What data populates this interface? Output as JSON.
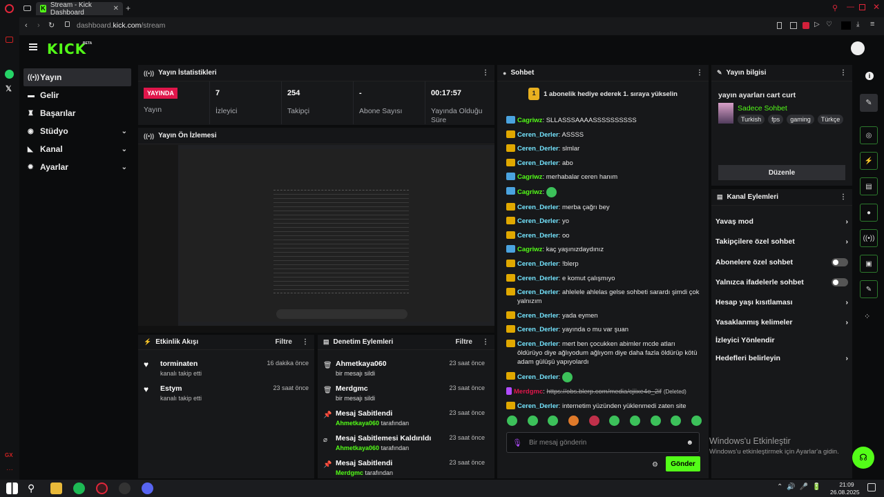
{
  "browser": {
    "tab_title": "Stream - Kick Dashboard",
    "url_domain": "dashboard.",
    "url_host": "kick.com",
    "url_path": "/stream"
  },
  "brand": {
    "logo": "KICK",
    "beta": "BETA",
    "accent": "#53fc18"
  },
  "sidebar": {
    "items": [
      {
        "label": "Yayın",
        "icon": "broadcast-icon"
      },
      {
        "label": "Gelir",
        "icon": "money-icon"
      },
      {
        "label": "Başarılar",
        "icon": "trophy-icon"
      },
      {
        "label": "Stüdyo",
        "icon": "studio-icon"
      },
      {
        "label": "Kanal",
        "icon": "channel-icon"
      },
      {
        "label": "Ayarlar",
        "icon": "gear-icon"
      }
    ]
  },
  "stats": {
    "title": "Yayın İstatistikleri",
    "live_badge": "YAYINDA",
    "live_label": "Yayın",
    "items": [
      {
        "value": "7",
        "label": "İzleyici"
      },
      {
        "value": "254",
        "label": "Takipçi"
      },
      {
        "value": "-",
        "label": "Abone Sayısı"
      },
      {
        "value": "00:17:57",
        "label": "Yayında Olduğu Süre"
      }
    ]
  },
  "preview": {
    "title": "Yayın Ön İzlemesi"
  },
  "activity": {
    "title": "Etkinlik Akışı",
    "filter": "Filtre",
    "items": [
      {
        "name": "torminaten",
        "sub": "kanalı takip etti",
        "time": "16 dakika önce"
      },
      {
        "name": "Estym",
        "sub": "kanalı takip etti",
        "time": "23 saat önce"
      }
    ]
  },
  "moderation": {
    "title": "Denetim Eylemleri",
    "filter": "Filtre",
    "items": [
      {
        "title": "Ahmetkaya060",
        "sub": "bir mesajı sildi",
        "time": "23 saat önce",
        "user": "",
        "icon": "trash-icon"
      },
      {
        "title": "Merdgmc",
        "sub": "bir mesajı sildi",
        "time": "23 saat önce",
        "user": "",
        "icon": "trash-icon"
      },
      {
        "title": "Mesaj Sabitlendi",
        "sub": "tarafından",
        "time": "23 saat önce",
        "user": "Ahmetkaya060",
        "icon": "pin-icon"
      },
      {
        "title": "Mesaj Sabitlemesi Kaldırıldı",
        "sub": "tarafından",
        "time": "23 saat önce",
        "user": "Ahmetkaya060",
        "icon": "unpin-icon"
      },
      {
        "title": "Mesaj Sabitlendi",
        "sub": "tarafından",
        "time": "23 saat önce",
        "user": "Merdgmc",
        "icon": "pin-icon"
      }
    ]
  },
  "chat": {
    "title": "Sohbet",
    "gift_banner": "1 abonelik hediye ederek 1. sıraya yükselin",
    "gift_rank": "1",
    "input_placeholder": "Bir mesaj gönderin",
    "send": "Gönder",
    "messages": [
      {
        "user": "Cagriwz",
        "text": "SLLASSSAAAASSSSSSSSSS",
        "badge": "blue"
      },
      {
        "user": "Ceren_Derler",
        "text": "ASSSS",
        "badge": "gold"
      },
      {
        "user": "Ceren_Derler",
        "text": "slmlar",
        "badge": "gold"
      },
      {
        "user": "Ceren_Derler",
        "text": "abo",
        "badge": "gold"
      },
      {
        "user": "Cagriwz",
        "text": "merhabalar ceren hanım",
        "badge": "blue"
      },
      {
        "user": "Cagriwz",
        "text": "",
        "badge": "blue",
        "emote": true
      },
      {
        "user": "Ceren_Derler",
        "text": "merba çağrı bey",
        "badge": "gold"
      },
      {
        "user": "Ceren_Derler",
        "text": "yo",
        "badge": "gold"
      },
      {
        "user": "Ceren_Derler",
        "text": "oo",
        "badge": "gold"
      },
      {
        "user": "Cagriwz",
        "text": "kaç yaşınızdaydınız",
        "badge": "blue"
      },
      {
        "user": "Ceren_Derler",
        "text": "!blerp",
        "badge": "gold"
      },
      {
        "user": "Ceren_Derler",
        "text": "e komut çalışmıyo",
        "badge": "gold"
      },
      {
        "user": "Ceren_Derler",
        "text": "ahlelele ahlelas gelse sohbeti sarardı şimdi çok yalnızım",
        "badge": "gold"
      },
      {
        "user": "Ceren_Derler",
        "text": "yada eymen",
        "badge": "gold"
      },
      {
        "user": "Ceren_Derler",
        "text": "yayında o mu var şuan",
        "badge": "gold"
      },
      {
        "user": "Ceren_Derler",
        "text": "mert ben çocukken abimler mcde atları öldürüyo diye ağlıyodum ağlıyom diye daha fazla öldürüp kötü adam gülüşü yapıyolardı",
        "badge": "gold"
      },
      {
        "user": "Ceren_Derler",
        "text": "",
        "badge": "gold",
        "emote": true
      },
      {
        "user": "Merdgmc",
        "text": "https://obs.blerp.com/media/cjiixe4o_2if",
        "deleted": "(Deleted)",
        "badge": "mic"
      },
      {
        "user": "Ceren_Derler",
        "text": "internetim yüzünden yüklenmedi zaten site",
        "badge": "gold"
      }
    ]
  },
  "stream_info": {
    "title": "Yayın bilgisi",
    "stream_title": "yayın ayarları cart curt",
    "category": "Sadece Sohbet",
    "tags": [
      "Turkish",
      "fps",
      "gaming",
      "Türkçe"
    ],
    "edit": "Düzenle"
  },
  "channel_actions": {
    "title": "Kanal Eylemleri",
    "items": [
      {
        "label": "Yavaş mod",
        "control": "chevron"
      },
      {
        "label": "Takipçilere özel sohbet",
        "control": "chevron"
      },
      {
        "label": "Abonelere özel sohbet",
        "control": "toggle",
        "on": false
      },
      {
        "label": "Yalnızca ifadelerle sohbet",
        "control": "toggle",
        "on": false
      },
      {
        "label": "Hesap yaşı kısıtlaması",
        "control": "chevron"
      },
      {
        "label": "Yasaklanmış kelimeler",
        "control": "chevron"
      },
      {
        "label": "İzleyici Yönlendir",
        "control": "none"
      },
      {
        "label": "Hedefleri belirleyin",
        "control": "chevron"
      }
    ]
  },
  "windows": {
    "activate_title": "Windows'u Etkinleştir",
    "activate_sub": "Windows'u etkinleştirmek için Ayarlar'a gidin.",
    "time": "21:09",
    "date": "26.08.2025"
  }
}
